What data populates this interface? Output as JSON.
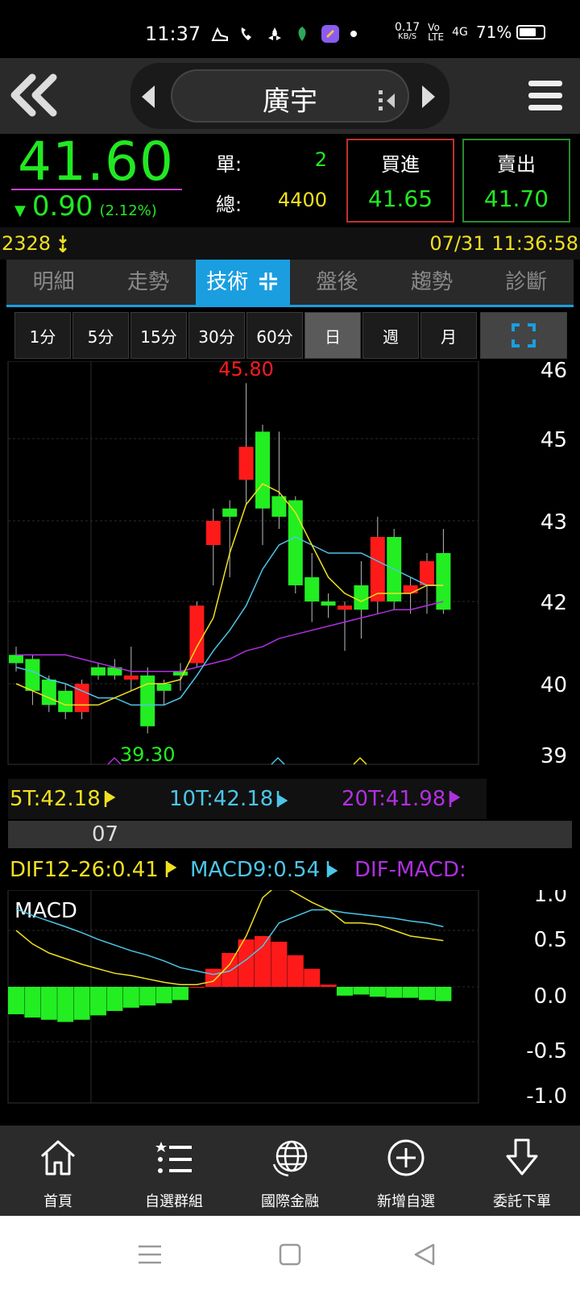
{
  "status_bar": {
    "time": "11:37",
    "net_speed_top": "0.17",
    "net_speed_unit": "KB/S",
    "signal": "4G",
    "battery_pct": "71%",
    "battery_level": 0.71
  },
  "header": {
    "stock_name": "廣宇"
  },
  "quote": {
    "price": "41.60",
    "change_arrow": "▼",
    "change": "0.90",
    "change_pct": "(2.12%)",
    "single_label": "單:",
    "single_value": "2",
    "total_label": "總:",
    "total_value": "4400",
    "buy_label": "買進",
    "buy_value": "41.65",
    "sell_label": "賣出",
    "sell_value": "41.70"
  },
  "volume_line": {
    "left": "2328",
    "right": "07/31 11:36:58"
  },
  "tabs": [
    {
      "label": "明細",
      "active": false
    },
    {
      "label": "走勢",
      "active": false
    },
    {
      "label": "技術",
      "active": true
    },
    {
      "label": "盤後",
      "active": false
    },
    {
      "label": "趨勢",
      "active": false
    },
    {
      "label": "診斷",
      "active": false
    }
  ],
  "periods": [
    {
      "label": "1分",
      "active": false
    },
    {
      "label": "5分",
      "active": false
    },
    {
      "label": "15分",
      "active": false
    },
    {
      "label": "30分",
      "active": false
    },
    {
      "label": "60分",
      "active": false
    },
    {
      "label": "日",
      "active": true
    },
    {
      "label": "週",
      "active": false
    },
    {
      "label": "月",
      "active": false
    }
  ],
  "ma_legend": {
    "ma5": "5T:42.18",
    "ma10": "10T:42.18",
    "ma20": "20T:41.98"
  },
  "date_label": "07",
  "macd_legend": {
    "dif": "DIF12-26:0.41",
    "macd": "MACD9:0.54",
    "osc": "DIF-MACD:"
  },
  "macd_title": "MACD",
  "colors": {
    "up": "#ff1a1a",
    "down": "#22ee22",
    "ma5": "#f0e020",
    "ma10": "#4cc6e8",
    "ma20": "#b030e0",
    "accent": "#1a9ee0"
  },
  "chart_data": [
    {
      "type": "candlestick",
      "ylim": [
        39,
        46
      ],
      "y_ticks": [
        "46",
        "45",
        "43",
        "42",
        "40",
        "39"
      ],
      "y_tick_values": [
        46,
        45,
        43,
        42,
        40,
        39
      ],
      "high_label": "45.80",
      "low_label": "39.30",
      "high_index": 14,
      "low_index": 8,
      "candles": [
        {
          "o": 40.7,
          "h": 40.9,
          "l": 40.3,
          "c": 40.5
        },
        {
          "o": 40.6,
          "h": 40.7,
          "l": 39.7,
          "c": 39.9
        },
        {
          "o": 40.1,
          "h": 40.2,
          "l": 39.6,
          "c": 39.7
        },
        {
          "o": 39.9,
          "h": 40.0,
          "l": 39.5,
          "c": 39.6
        },
        {
          "o": 39.6,
          "h": 40.1,
          "l": 39.5,
          "c": 40.0
        },
        {
          "o": 40.4,
          "h": 40.5,
          "l": 40.1,
          "c": 40.2
        },
        {
          "o": 40.4,
          "h": 40.6,
          "l": 40.1,
          "c": 40.2
        },
        {
          "o": 40.1,
          "h": 40.9,
          "l": 39.9,
          "c": 40.2
        },
        {
          "o": 40.2,
          "h": 40.4,
          "l": 39.3,
          "c": 39.4
        },
        {
          "o": 40.0,
          "h": 40.1,
          "l": 39.7,
          "c": 39.9
        },
        {
          "o": 40.3,
          "h": 40.5,
          "l": 39.9,
          "c": 40.2
        },
        {
          "o": 40.5,
          "h": 42.0,
          "l": 40.4,
          "c": 41.9
        },
        {
          "o": 42.7,
          "h": 43.3,
          "l": 42.2,
          "c": 43.0
        },
        {
          "o": 43.3,
          "h": 43.5,
          "l": 42.3,
          "c": 43.1
        },
        {
          "o": 44.0,
          "h": 45.8,
          "l": 43.4,
          "c": 44.8
        },
        {
          "o": 45.1,
          "h": 45.2,
          "l": 42.7,
          "c": 43.3
        },
        {
          "o": 43.6,
          "h": 45.1,
          "l": 42.9,
          "c": 43.1
        },
        {
          "o": 43.5,
          "h": 43.6,
          "l": 42.1,
          "c": 42.2
        },
        {
          "o": 42.3,
          "h": 42.6,
          "l": 41.5,
          "c": 42.0
        },
        {
          "o": 42.0,
          "h": 42.1,
          "l": 41.6,
          "c": 41.9
        },
        {
          "o": 41.8,
          "h": 42.0,
          "l": 40.8,
          "c": 41.9
        },
        {
          "o": 42.2,
          "h": 42.5,
          "l": 41.1,
          "c": 41.8
        },
        {
          "o": 42.0,
          "h": 43.1,
          "l": 41.7,
          "c": 42.8
        },
        {
          "o": 42.8,
          "h": 42.9,
          "l": 41.8,
          "c": 42.0
        },
        {
          "o": 42.1,
          "h": 42.3,
          "l": 41.7,
          "c": 42.2
        },
        {
          "o": 42.2,
          "h": 42.6,
          "l": 41.7,
          "c": 42.5
        },
        {
          "o": 42.6,
          "h": 42.9,
          "l": 41.7,
          "c": 41.8
        }
      ],
      "ma5": [
        40.0,
        39.9,
        39.8,
        39.7,
        39.7,
        39.7,
        39.8,
        39.9,
        40.0,
        40.0,
        40.1,
        40.9,
        41.6,
        42.6,
        43.4,
        43.9,
        43.7,
        43.2,
        42.7,
        42.3,
        42.1,
        42.0,
        42.1,
        42.1,
        42.1,
        42.2,
        42.2
      ],
      "ma10": [
        40.4,
        40.3,
        40.1,
        40.0,
        39.9,
        39.8,
        39.8,
        39.7,
        39.7,
        39.7,
        39.8,
        40.2,
        40.8,
        41.3,
        41.9,
        42.4,
        42.7,
        42.8,
        42.7,
        42.6,
        42.6,
        42.6,
        42.5,
        42.4,
        42.3,
        42.2,
        42.2
      ],
      "ma20": [
        40.7,
        40.7,
        40.7,
        40.7,
        40.6,
        40.5,
        40.4,
        40.3,
        40.3,
        40.3,
        40.3,
        40.4,
        40.5,
        40.6,
        40.8,
        40.9,
        41.1,
        41.2,
        41.3,
        41.4,
        41.5,
        41.6,
        41.7,
        41.8,
        41.8,
        41.9,
        42.0
      ],
      "ma5_last": "42.18",
      "ma10_last": "42.18",
      "ma20_last": "41.98"
    },
    {
      "type": "bar+line",
      "title": "MACD",
      "ylim": [
        -1.0,
        1.0
      ],
      "y_ticks": [
        "1.0",
        "0.5",
        "0.0",
        "-0.5",
        "-1.0"
      ],
      "y_tick_values": [
        1.0,
        0.5,
        0.0,
        -0.5,
        -1.0
      ],
      "osc": [
        -0.25,
        -0.28,
        -0.3,
        -0.32,
        -0.3,
        -0.26,
        -0.22,
        -0.19,
        -0.17,
        -0.15,
        -0.12,
        0.0,
        0.16,
        0.3,
        0.42,
        0.45,
        0.4,
        0.28,
        0.16,
        0.02,
        -0.08,
        -0.07,
        -0.09,
        -0.1,
        -0.1,
        -0.12,
        -0.13
      ],
      "dif": [
        0.5,
        0.38,
        0.3,
        0.25,
        0.2,
        0.16,
        0.12,
        0.1,
        0.07,
        0.04,
        0.02,
        0.02,
        0.05,
        0.2,
        0.45,
        0.85,
        1.0,
        0.9,
        0.8,
        0.72,
        0.58,
        0.58,
        0.56,
        0.5,
        0.45,
        0.43,
        0.41
      ],
      "macd": [
        0.73,
        0.66,
        0.6,
        0.54,
        0.48,
        0.42,
        0.37,
        0.32,
        0.28,
        0.23,
        0.17,
        0.14,
        0.11,
        0.14,
        0.24,
        0.36,
        0.58,
        0.65,
        0.72,
        0.72,
        0.69,
        0.67,
        0.65,
        0.63,
        0.6,
        0.58,
        0.54
      ],
      "dif_last": "0.41",
      "macd_last": "0.54"
    }
  ],
  "bottom_nav": [
    {
      "label": "首頁",
      "icon": "home-icon"
    },
    {
      "label": "自選群組",
      "icon": "list-icon"
    },
    {
      "label": "國際金融",
      "icon": "globe-icon"
    },
    {
      "label": "新增自選",
      "icon": "add-icon"
    },
    {
      "label": "委託下單",
      "icon": "order-icon"
    }
  ]
}
